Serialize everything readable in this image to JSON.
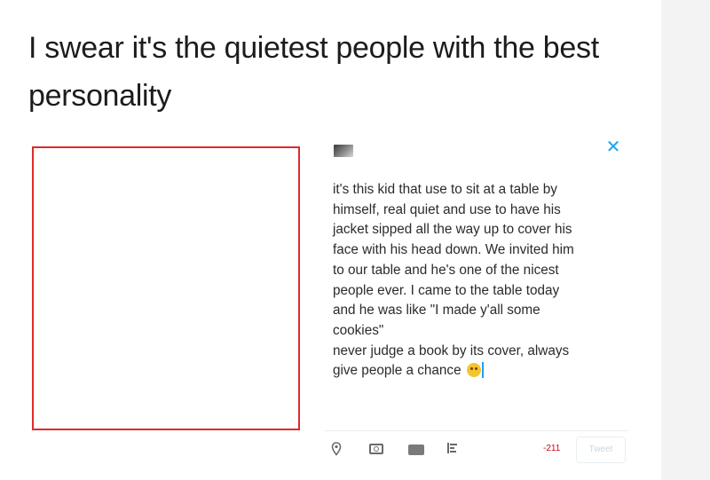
{
  "headline": "I swear it's the quietest people with the best personality",
  "tweet": {
    "close_icon": "✕",
    "body": "it's this kid that use to sit at a table by\nhimself, real quiet and use to have his\njacket sipped all the way up to cover his\nface with his head down. We invited him\nto our table and he's one of the nicest\npeople ever. I came to the table today\nand he was like \"I made y'all some\ncookies\"\nnever judge a book by its cover, always\ngive people a chance",
    "emoji": "grinning-face-emoji",
    "toolbar": {
      "icons": [
        "location-pin-icon",
        "camera-icon",
        "gif-icon",
        "poll-icon"
      ],
      "char_count": "-211",
      "tweet_label": "Tweet"
    }
  },
  "colors": {
    "accent": "#1da1f2",
    "photo_border": "#e02a2a",
    "char_count": "#d0021b"
  }
}
